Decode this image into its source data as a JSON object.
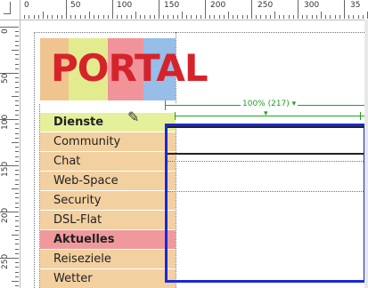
{
  "ruler": {
    "top_labels": [
      "0",
      "50",
      "100",
      "150",
      "200",
      "250",
      "300",
      "35"
    ],
    "left_labels": [
      "0",
      "50",
      "100",
      "150",
      "200",
      "250"
    ]
  },
  "logo": {
    "text": "PORTAL",
    "stripes": [
      "#f0c48e",
      "#e2ec8f",
      "#f0949a",
      "#97bde9"
    ]
  },
  "nav": [
    {
      "label": "Dienste",
      "bg": "#e6f09a",
      "bold": true
    },
    {
      "label": "Community",
      "bg": "#f3d0a0",
      "bold": false
    },
    {
      "label": "Chat",
      "bg": "#f3d0a0",
      "bold": false
    },
    {
      "label": "Web-Space",
      "bg": "#f3d0a0",
      "bold": false
    },
    {
      "label": "Security",
      "bg": "#f3d0a0",
      "bold": false
    },
    {
      "label": "DSL-Flat",
      "bg": "#f3d0a0",
      "bold": false
    },
    {
      "label": "Aktuelles",
      "bg": "#f0999d",
      "bold": true
    },
    {
      "label": "Reiseziele",
      "bg": "#f3d0a0",
      "bold": false
    },
    {
      "label": "Wetter",
      "bg": "#f3d0a0",
      "bold": false
    }
  ],
  "table_width_label": "100% (217) ▾",
  "colors": {
    "selection_blue": "#1a28d8",
    "guide_green": "#1fa01f"
  }
}
